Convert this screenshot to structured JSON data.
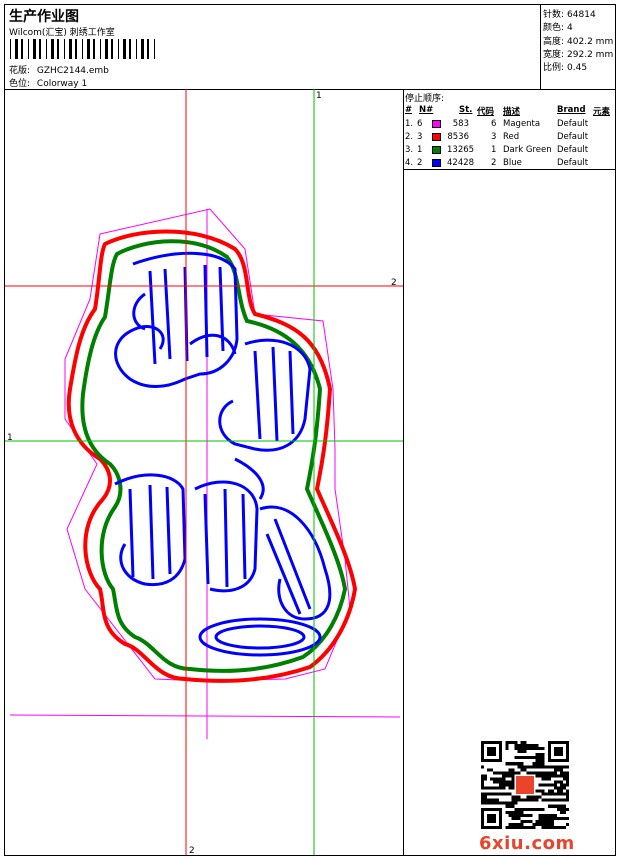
{
  "header": {
    "title": "生产作业图",
    "subtitle": "Wilcom(汇宝) 刺绣工作室",
    "design_label": "花版:",
    "design_value": "GZHC2144.emb",
    "colorway_label": "色位:",
    "colorway_value": "Colorway 1"
  },
  "stats": [
    {
      "label": "针数:",
      "value": "64814"
    },
    {
      "label": "颜色:",
      "value": "4"
    },
    {
      "label": "高度:",
      "value": "402.2 mm"
    },
    {
      "label": "宽度:",
      "value": "292.2 mm"
    },
    {
      "label": "比例:",
      "value": "0.45"
    }
  ],
  "stop_sequence": {
    "title": "停止顺序:",
    "headers": {
      "num": "#",
      "n": "N#",
      "st": "St.",
      "code": "代码",
      "desc": "描述",
      "brand": "Brand",
      "elem": "元素"
    },
    "rows": [
      {
        "num": "1.",
        "n": "6",
        "color": "#ff00ff",
        "st": "583",
        "code": "6",
        "desc": "Magenta",
        "brand": "Default"
      },
      {
        "num": "2.",
        "n": "3",
        "color": "#ff0000",
        "st": "8536",
        "code": "3",
        "desc": "Red",
        "brand": "Default"
      },
      {
        "num": "3.",
        "n": "1",
        "color": "#008000",
        "st": "13265",
        "code": "1",
        "desc": "Dark Green",
        "brand": "Default"
      },
      {
        "num": "4.",
        "n": "2",
        "color": "#0000ff",
        "st": "42428",
        "code": "2",
        "desc": "Blue",
        "brand": "Default"
      }
    ]
  },
  "guides": {
    "v_red": "2",
    "h_red": "2",
    "v_green": "1",
    "h_green": "1"
  },
  "watermark": "6xiu.com",
  "colors": {
    "magenta": "#ff00ff",
    "red": "#ff0000",
    "green": "#008000",
    "blue": "#0000ff",
    "logo": "#e8452c"
  }
}
